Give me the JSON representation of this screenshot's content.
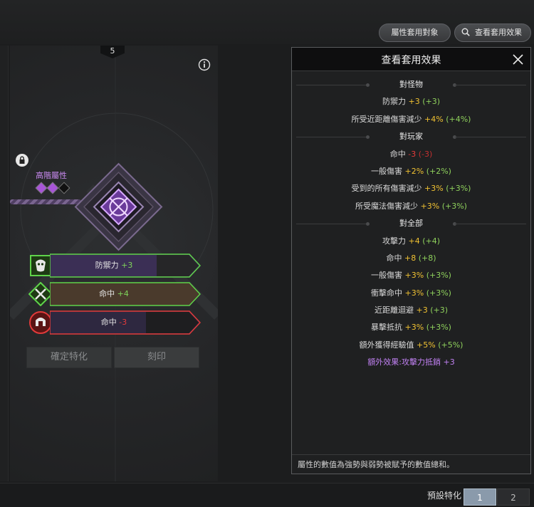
{
  "toolbar": {
    "apply_target_label": "屬性套用對象",
    "view_effect_label": "查看套用效果"
  },
  "spec_panel": {
    "tab_number": "5",
    "advanced_label": "高階屬性",
    "gems": [
      "#a855d8",
      "#a855d8",
      "#111111"
    ],
    "slots": [
      {
        "name": "防禦力",
        "value": "+3",
        "value_color": "green",
        "border_color": "#5fd34a"
      },
      {
        "name": "命中",
        "value": "+4",
        "value_color": "green",
        "border_color": "#5fd34a"
      },
      {
        "name": "命中",
        "value": "-3",
        "value_color": "red",
        "border_color": "#e23a3a"
      }
    ],
    "confirm_label": "確定特化",
    "engrave_label": "刻印"
  },
  "effect_panel": {
    "title": "查看套用效果",
    "rows": [
      {
        "type": "section",
        "label": "對怪物"
      },
      {
        "type": "stat",
        "name": "防禦力",
        "value": "+3",
        "value_color": "yellow",
        "extra": "(+3)",
        "extra_color": "green"
      },
      {
        "type": "stat",
        "name": "所受近距離傷害減少",
        "value": "+4%",
        "value_color": "yellow",
        "extra": "(+4%)",
        "extra_color": "green"
      },
      {
        "type": "section",
        "label": "對玩家"
      },
      {
        "type": "stat",
        "name": "命中",
        "value": "-3",
        "value_color": "red",
        "extra": "(-3)",
        "extra_color": "red-dim"
      },
      {
        "type": "stat",
        "name": "一般傷害",
        "value": "+2%",
        "value_color": "yellow",
        "extra": "(+2%)",
        "extra_color": "green"
      },
      {
        "type": "stat",
        "name": "受到的所有傷害減少",
        "value": "+3%",
        "value_color": "yellow",
        "extra": "(+3%)",
        "extra_color": "green"
      },
      {
        "type": "stat",
        "name": "所受魔法傷害減少",
        "value": "+3%",
        "value_color": "yellow",
        "extra": "(+3%)",
        "extra_color": "green"
      },
      {
        "type": "section",
        "label": "對全部"
      },
      {
        "type": "stat",
        "name": "攻擊力",
        "value": "+4",
        "value_color": "yellow",
        "extra": "(+4)",
        "extra_color": "green"
      },
      {
        "type": "stat",
        "name": "命中",
        "value": "+8",
        "value_color": "yellow",
        "extra": "(+8)",
        "extra_color": "green"
      },
      {
        "type": "stat",
        "name": "一般傷害",
        "value": "+3%",
        "value_color": "yellow",
        "extra": "(+3%)",
        "extra_color": "green"
      },
      {
        "type": "stat",
        "name": "衝擊命中",
        "value": "+3%",
        "value_color": "yellow",
        "extra": "(+3%)",
        "extra_color": "green"
      },
      {
        "type": "stat",
        "name": "近距離迴避",
        "value": "+3",
        "value_color": "yellow",
        "extra": "(+3)",
        "extra_color": "green"
      },
      {
        "type": "stat",
        "name": "暴擊抵抗",
        "value": "+3%",
        "value_color": "yellow",
        "extra": "(+3%)",
        "extra_color": "green"
      },
      {
        "type": "stat",
        "name": "額外獲得經驗值",
        "value": "+5%",
        "value_color": "yellow",
        "extra": "(+5%)",
        "extra_color": "green"
      },
      {
        "type": "bonus",
        "name": "額外效果:攻擊力抵銷",
        "value": "+3"
      }
    ],
    "footer": "屬性的數值為強勢與弱勢被賦予的數值總和。"
  },
  "bottom": {
    "preset_label": "預設特化",
    "presets": [
      "1",
      "2"
    ],
    "active_preset": "1"
  },
  "colors": {
    "yellow": "#f1c232",
    "green": "#8fd15c",
    "red": "#e43b3b",
    "purple": "#c080f2"
  }
}
